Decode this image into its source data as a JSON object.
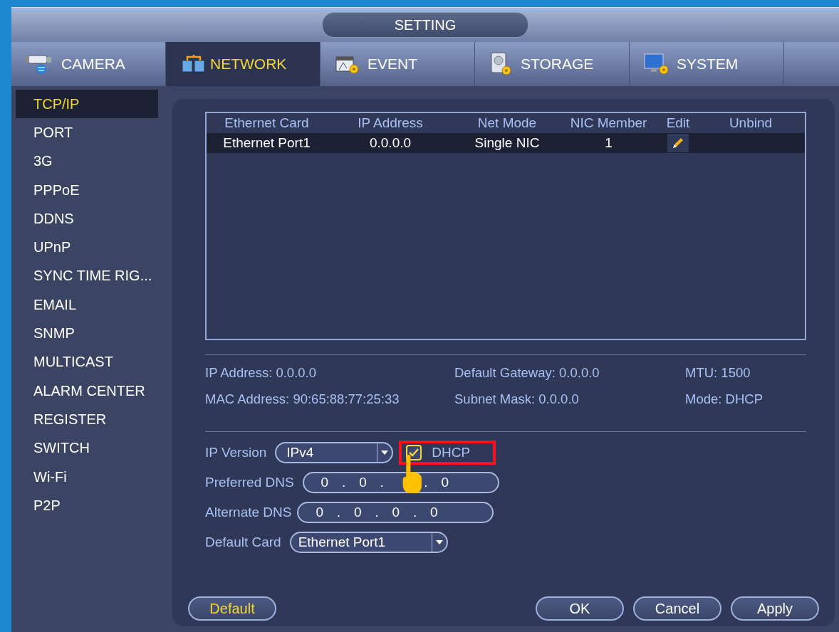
{
  "window": {
    "title": "SETTING"
  },
  "tabs": [
    {
      "label": "CAMERA",
      "selected": false
    },
    {
      "label": "NETWORK",
      "selected": true
    },
    {
      "label": "EVENT",
      "selected": false
    },
    {
      "label": "STORAGE",
      "selected": false
    },
    {
      "label": "SYSTEM",
      "selected": false
    }
  ],
  "sidebar": {
    "items": [
      {
        "label": "TCP/IP",
        "selected": true
      },
      {
        "label": "PORT",
        "selected": false
      },
      {
        "label": "3G",
        "selected": false
      },
      {
        "label": "PPPoE",
        "selected": false
      },
      {
        "label": "DDNS",
        "selected": false
      },
      {
        "label": "UPnP",
        "selected": false
      },
      {
        "label": "SYNC TIME RIG...",
        "selected": false
      },
      {
        "label": "EMAIL",
        "selected": false
      },
      {
        "label": "SNMP",
        "selected": false
      },
      {
        "label": "MULTICAST",
        "selected": false
      },
      {
        "label": "ALARM CENTER",
        "selected": false
      },
      {
        "label": "REGISTER",
        "selected": false
      },
      {
        "label": "SWITCH",
        "selected": false
      },
      {
        "label": "Wi-Fi",
        "selected": false
      },
      {
        "label": "P2P",
        "selected": false
      }
    ]
  },
  "table": {
    "columns": [
      "Ethernet Card",
      "IP Address",
      "Net Mode",
      "NIC Member",
      "Edit",
      "Unbind"
    ],
    "rows": [
      {
        "cells": [
          "Ethernet Port1",
          "0.0.0.0",
          "Single NIC",
          "1"
        ],
        "editable": true,
        "selected": true
      }
    ]
  },
  "info": [
    {
      "label": "IP Address:",
      "value": "0.0.0.0"
    },
    {
      "label": "Default Gateway:",
      "value": "0.0.0.0"
    },
    {
      "label": "MTU:",
      "value": "1500"
    },
    {
      "label": "MAC Address:",
      "value": "90:65:88:77:25:33"
    },
    {
      "label": "Subnet Mask:",
      "value": "0.0.0.0"
    },
    {
      "label": "Mode:",
      "value": "DHCP"
    }
  ],
  "form": {
    "ip_version": {
      "label": "IP Version",
      "value": "IPv4"
    },
    "dhcp": {
      "label": "DHCP",
      "checked": true,
      "highlighted": true
    },
    "preferred_dns": {
      "label": "Preferred DNS",
      "value": "0   .   0   .         .   0"
    },
    "alternate_dns": {
      "label": "Alternate DNS",
      "value": "0   .   0   .   0   .   0"
    },
    "default_card": {
      "label": "Default Card",
      "value": "Ethernet Port1"
    }
  },
  "buttons": [
    {
      "label": "Default",
      "kind": "default"
    },
    {
      "label": "OK",
      "kind": "normal"
    },
    {
      "label": "Cancel",
      "kind": "normal"
    },
    {
      "label": "Apply",
      "kind": "normal"
    }
  ]
}
